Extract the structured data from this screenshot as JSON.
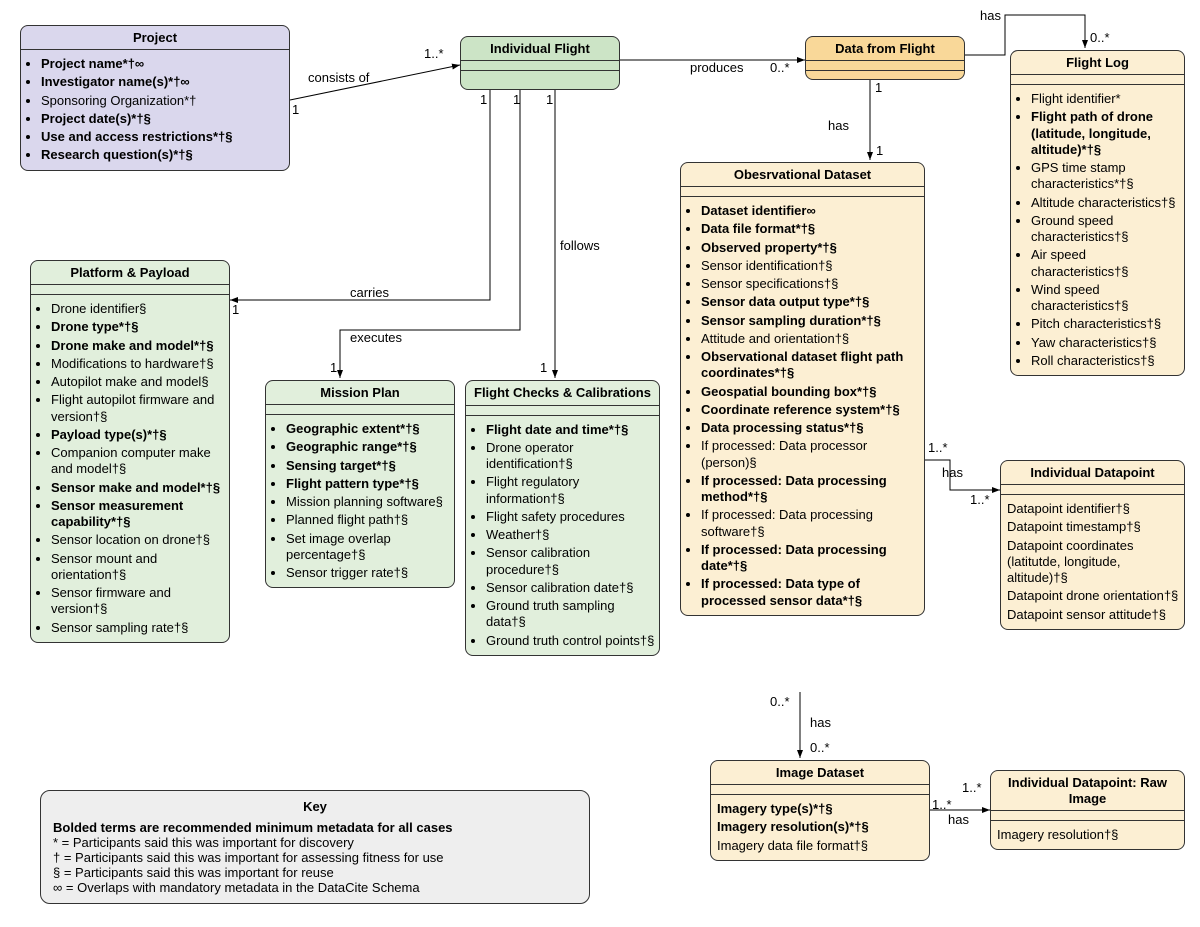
{
  "project": {
    "title": "Project",
    "items": [
      {
        "t": "Project name*†∞",
        "b": true
      },
      {
        "t": "Investigator name(s)*†∞",
        "b": true
      },
      {
        "t": "Sponsoring Organization*†",
        "b": false
      },
      {
        "t": "Project date(s)*†§",
        "b": true
      },
      {
        "t": "Use and access restrictions*†§",
        "b": true
      },
      {
        "t": "Research question(s)*†§",
        "b": true
      }
    ]
  },
  "indflight": {
    "title": "Individual Flight"
  },
  "dataflight": {
    "title": "Data from Flight"
  },
  "platform": {
    "title": "Platform & Payload",
    "items": [
      {
        "t": "Drone identifier§",
        "b": false
      },
      {
        "t": "Drone type*†§",
        "b": true
      },
      {
        "t": "Drone make and model*†§",
        "b": true
      },
      {
        "t": "Modifications to hardware†§",
        "b": false
      },
      {
        "t": "Autopilot make and model§",
        "b": false
      },
      {
        "t": "Flight autopilot firmware and version†§",
        "b": false
      },
      {
        "t": "Payload type(s)*†§",
        "b": true
      },
      {
        "t": "Companion computer make and model†§",
        "b": false
      },
      {
        "t": "Sensor make and model*†§",
        "b": true
      },
      {
        "t": "Sensor measurement capability*†§",
        "b": true
      },
      {
        "t": "Sensor location on drone†§",
        "b": false
      },
      {
        "t": "Sensor mount and orientation†§",
        "b": false
      },
      {
        "t": "Sensor firmware and version†§",
        "b": false
      },
      {
        "t": "Sensor sampling rate†§",
        "b": false
      }
    ]
  },
  "mission": {
    "title": "Mission Plan",
    "items": [
      {
        "t": "Geographic extent*†§",
        "b": true
      },
      {
        "t": "Geographic range*†§",
        "b": true
      },
      {
        "t": "Sensing target*†§",
        "b": true
      },
      {
        "t": "Flight pattern type*†§",
        "b": true
      },
      {
        "t": "Mission planning software§",
        "b": false
      },
      {
        "t": "Planned flight path†§",
        "b": false
      },
      {
        "t": "Set image overlap percentage†§",
        "b": false
      },
      {
        "t": "Sensor trigger rate†§",
        "b": false
      }
    ]
  },
  "checks": {
    "title": "Flight Checks & Calibrations",
    "items": [
      {
        "t": "Flight date and time*†§",
        "b": true
      },
      {
        "t": "Drone operator identification†§",
        "b": false
      },
      {
        "t": "Flight regulatory information†§",
        "b": false
      },
      {
        "t": "Flight safety procedures",
        "b": false
      },
      {
        "t": "Weather†§",
        "b": false
      },
      {
        "t": "Sensor calibration procedure†§",
        "b": false
      },
      {
        "t": "Sensor calibration date†§",
        "b": false
      },
      {
        "t": "Ground truth sampling data†§",
        "b": false
      },
      {
        "t": "Ground truth control points†§",
        "b": false
      }
    ]
  },
  "obs": {
    "title": "Obesrvational Dataset",
    "items": [
      {
        "t": "Dataset identifier∞",
        "b": true
      },
      {
        "t": "Data file format*†§",
        "b": true
      },
      {
        "t": "Observed property*†§",
        "b": true
      },
      {
        "t": "Sensor identification†§",
        "b": false
      },
      {
        "t": "Sensor specifications†§",
        "b": false
      },
      {
        "t": "Sensor data output type*†§",
        "b": true
      },
      {
        "t": "Sensor sampling duration*†§",
        "b": true
      },
      {
        "t": "Attitude and orientation†§",
        "b": false
      },
      {
        "t": "Observational dataset flight path coordinates*†§",
        "b": true
      },
      {
        "t": "Geospatial bounding box*†§",
        "b": true
      },
      {
        "t": "Coordinate reference system*†§",
        "b": true
      },
      {
        "t": "Data processing status*†§",
        "b": true
      },
      {
        "t": "If processed: Data processor (person)§",
        "b": false
      },
      {
        "t": "If processed: Data processing method*†§",
        "b": true
      },
      {
        "t": "If processed: Data processing software†§",
        "b": false
      },
      {
        "t": "If processed: Data processing date*†§",
        "b": true
      },
      {
        "t": "If processed: Data type of processed sensor data*†§",
        "b": true
      }
    ]
  },
  "flightlog": {
    "title": "Flight Log",
    "items": [
      {
        "t": "Flight identifier*",
        "b": false
      },
      {
        "t": "Flight path of drone (latitude, longitude, altitude)*†§",
        "b": true
      },
      {
        "t": "GPS time stamp characteristics*†§",
        "b": false
      },
      {
        "t": "Altitude characteristics†§",
        "b": false
      },
      {
        "t": "Ground speed characteristics†§",
        "b": false
      },
      {
        "t": "Air speed characteristics†§",
        "b": false
      },
      {
        "t": "Wind speed characteristics†§",
        "b": false
      },
      {
        "t": "Pitch characteristics†§",
        "b": false
      },
      {
        "t": "Yaw characteristics†§",
        "b": false
      },
      {
        "t": "Roll characteristics†§",
        "b": false
      }
    ]
  },
  "datapoint": {
    "title": "Individual Datapoint",
    "items": [
      {
        "t": "Datapoint identifier†§"
      },
      {
        "t": "Datapoint timestamp†§"
      },
      {
        "t": "Datapoint coordinates (latitutde, longitude, altitude)†§"
      },
      {
        "t": "Datapoint drone orientation†§"
      },
      {
        "t": "Datapoint sensor attitude†§"
      }
    ]
  },
  "imgds": {
    "title": "Image Dataset",
    "items": [
      {
        "t": "Imagery type(s)*†§",
        "b": true
      },
      {
        "t": "Imagery resolution(s)*†§",
        "b": true
      },
      {
        "t": "Imagery data file format†§",
        "b": false
      }
    ]
  },
  "rawimg": {
    "title": "Individual Datapoint: Raw Image",
    "items": [
      {
        "t": "Imagery resolution†§"
      }
    ]
  },
  "key": {
    "title": "Key",
    "lines": [
      {
        "t": "Bolded terms are recommended minimum metadata for all cases",
        "b": true
      },
      {
        "t": "* = Participants said this was important for discovery"
      },
      {
        "t": "† = Participants said this was important for assessing fitness for use"
      },
      {
        "t": "§ = Participants said this was important for reuse"
      },
      {
        "t": "∞ = Overlaps with mandatory metadata in the DataCite Schema"
      }
    ]
  },
  "labels": {
    "consists": "consists of",
    "produces": "produces",
    "has": "has",
    "carries": "carries",
    "executes": "executes",
    "follows": "follows"
  },
  "mult": {
    "one": "1",
    "oneStar": "1..*",
    "zeroStar": "0..*"
  }
}
